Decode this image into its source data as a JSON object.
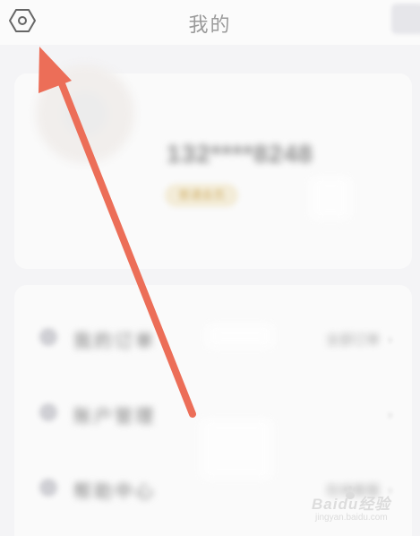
{
  "header": {
    "title": "我的",
    "settings_icon": "settings-hexagon-icon",
    "message_icon": "message-icon"
  },
  "profile": {
    "phone": "132****8248",
    "badge": "普通会员"
  },
  "menu": {
    "items": [
      {
        "label": "我的订单",
        "value": "全部订单"
      },
      {
        "label": "账户管理",
        "value": ""
      },
      {
        "label": "帮助中心",
        "value": "在线客服"
      }
    ]
  },
  "annotation": {
    "arrow_color": "#ec6e58"
  },
  "watermark": {
    "brand": "Baidu经验",
    "url": "jingyan.baidu.com"
  }
}
